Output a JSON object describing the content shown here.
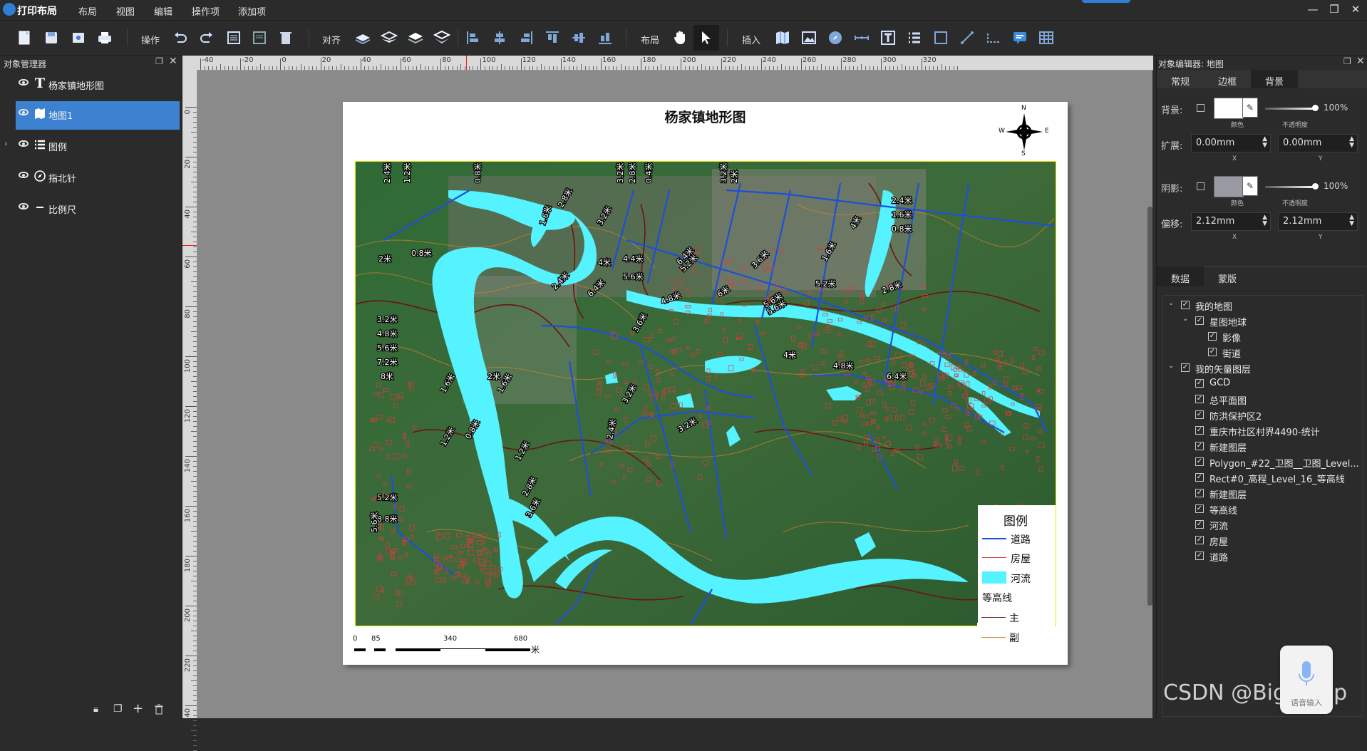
{
  "app": {
    "title": "打印布局"
  },
  "menu": [
    "布局",
    "视图",
    "编辑",
    "操作项",
    "添加项"
  ],
  "toolbar": {
    "group_operate": "操作",
    "group_align": "对齐",
    "group_layout": "布局",
    "group_insert": "插入"
  },
  "object_manager": {
    "title": "对象管理器",
    "items": [
      {
        "label": "杨家镇地形图",
        "type_icon": "text-icon"
      },
      {
        "label": "地图1",
        "type_icon": "map-icon",
        "selected": true
      },
      {
        "label": "图例",
        "type_icon": "legend-icon"
      },
      {
        "label": "指北针",
        "type_icon": "compass-icon"
      },
      {
        "label": "比例尺",
        "type_icon": "scalebar-icon"
      }
    ]
  },
  "ruler": {
    "top": [
      "-40",
      "-20",
      "0",
      "20",
      "40",
      "60",
      "80",
      "100",
      "120",
      "140",
      "160",
      "180",
      "200",
      "220",
      "240",
      "260",
      "280",
      "300",
      "320"
    ],
    "left": [
      "0",
      "20",
      "40",
      "60",
      "80",
      "100",
      "120",
      "140",
      "160",
      "180",
      "200",
      "220",
      "240"
    ]
  },
  "page": {
    "title": "杨家镇地形图",
    "compass": {
      "n": "N",
      "s": "S",
      "e": "E",
      "w": "W"
    },
    "legend": {
      "title": "图例",
      "items": [
        {
          "label": "道路",
          "color": "#1e4fd8"
        },
        {
          "label": "房屋",
          "color": "#e23a3a"
        },
        {
          "label": "河流",
          "color": "#55f2ff"
        }
      ],
      "contour_title": "等高线",
      "contour_items": [
        {
          "label": "主",
          "color": "#7a1a1a"
        },
        {
          "label": "副",
          "color": "#d9822b"
        }
      ]
    },
    "scalebar": {
      "ticks": [
        "0",
        "85",
        "340",
        "680"
      ],
      "unit": "米"
    },
    "map_labels": [
      "2.4米",
      "1.2米",
      "0.8米",
      "3.2米",
      "2.8米",
      "0.4米",
      "3.2米",
      "2米",
      "2.8米",
      "1.6米",
      "4米",
      "3.2米",
      "2.4米",
      "1.6米",
      "0.8米",
      "2米",
      "0.8米",
      "4米",
      "4.4米",
      "5.6米",
      "5.2米",
      "3.6米",
      "2.4米",
      "6.4米",
      "6.4米",
      "4.8米",
      "6米",
      "5.6米",
      "5.2米",
      "2.8米",
      "3.2米",
      "4.8米",
      "5.6米",
      "7.2米",
      "8米",
      "1.6米",
      "1.6米",
      "2米",
      "3.6米",
      "5.6米",
      "4米",
      "4.8米",
      "6.4米",
      "3.2米",
      "2.4米",
      "3.2米",
      "1.6米",
      "1.2米",
      "0.8米",
      "1.2米",
      "2.8米",
      "3.6米",
      "5.2米",
      "8.8米",
      "5.6米"
    ]
  },
  "object_editor": {
    "title": "对象编辑器: 地图",
    "tabs": [
      "常规",
      "边框",
      "背景"
    ],
    "active_tab": "背景",
    "background": {
      "label": "背景:",
      "opacity": "100%",
      "color_sub": "颜色",
      "opacity_sub": "不透明度"
    },
    "expand": {
      "label": "扩展:",
      "x": "0.00mm",
      "y": "0.00mm",
      "x_sub": "X",
      "y_sub": "Y"
    },
    "shadow": {
      "label": "阴影:",
      "opacity": "100%",
      "color_sub": "颜色",
      "opacity_sub": "不透明度"
    },
    "offset": {
      "label": "偏移:",
      "x": "2.12mm",
      "y": "2.12mm",
      "x_sub": "X",
      "y_sub": "Y"
    },
    "data_tabs": [
      "数据",
      "蒙版"
    ],
    "layers": {
      "root1": "我的地图",
      "globe": "星图地球",
      "imagery": "影像",
      "streets": "街道",
      "root2": "我的矢量图层",
      "vector": [
        "GCD",
        "总平面图",
        "防洪保护区2",
        "重庆市社区村界4490-统计",
        "新建图层",
        "Polygon_#22_卫图__卫图_Level...",
        "Rect#0_高程_Level_16_等高线",
        "新建图层",
        "等高线",
        "河流",
        "房屋",
        "道路"
      ]
    }
  },
  "watermark": "CSDN @Bigemap",
  "voice_widget": "语音输入"
}
